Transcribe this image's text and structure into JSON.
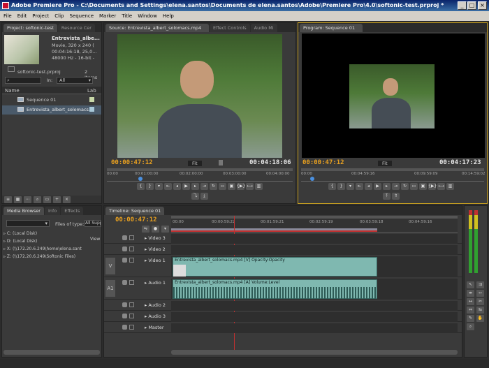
{
  "window": {
    "title": "Adobe Premiere Pro - C:\\Documents and Settings\\elena.santos\\Documents de elena.santos\\Adobe\\Premiere Pro\\4.0\\softonic-test.prproj *"
  },
  "menu": [
    "File",
    "Edit",
    "Project",
    "Clip",
    "Sequence",
    "Marker",
    "Title",
    "Window",
    "Help"
  ],
  "project": {
    "tabs": [
      "Project: softonic-test",
      "Resource Cer"
    ],
    "clip_name": "Entrevista_albe...",
    "clip_info": [
      "Movie, 320 x 240 (",
      "00:04:16:18, 25,0...",
      "48000 Hz - 16-bit -"
    ],
    "file": "softonic-test.prproj",
    "items": "2 Items",
    "in_label": "In:",
    "in_value": "All",
    "col_name": "Name",
    "col_label": "Lab",
    "rows": [
      "Sequence 01",
      "Entrevista_albert_solomacs."
    ]
  },
  "source": {
    "tabs": [
      "Source: Entrevista_albert_solomacs.mp4",
      "Effect Controls",
      "Audio Mi"
    ],
    "tc_current": "00:00:47:12",
    "fit": "Fit",
    "tc_duration": "00:04:18:06",
    "ruler": [
      "00:00",
      "00:01:00:00",
      "00:02:00:00",
      "00:03:00:00",
      "00:04:00:00"
    ],
    "playhead": 0.18
  },
  "program": {
    "tabs": [
      "Program: Sequence 01"
    ],
    "tc_current": "00:00:47:12",
    "fit": "Fit",
    "tc_duration": "00:04:17:23",
    "ruler": [
      "00:00",
      "00:04:59:16",
      "00:09:59:09",
      "00:14:59:02"
    ],
    "playhead": 0.06
  },
  "media_browser": {
    "tabs": [
      "Media Browser",
      "Info",
      "Effects"
    ],
    "files_of_type": "Files of type:",
    "files_value": "All Supp",
    "drives": [
      "C: (Local Disk)",
      "D: (Local Disk)",
      "X: (\\\\172.20.6.249\\home\\elena.sant",
      "Z: (\\\\172.20.6.249\\Softonic Files)"
    ],
    "view_label": "View"
  },
  "timeline": {
    "tab": "Timeline: Sequence 01",
    "tc": "00:00:47:12",
    "ruler": [
      "00:00",
      "00:00:59:22",
      "00:01:59:21",
      "00:02:59:19",
      "00:03:59:18",
      "00:04:59:16"
    ],
    "playhead": 0.22,
    "tracks": [
      {
        "label": "Video 3",
        "kind": "v"
      },
      {
        "label": "Video 2",
        "kind": "v"
      },
      {
        "label": "Video 1",
        "kind": "v",
        "src": "V",
        "clip": "Entrevista_albert_solomacs.mp4 [V]  Opacity:Opacity"
      },
      {
        "label": "Audio 1",
        "kind": "a",
        "src": "A1",
        "clip": "Entrevista_albert_solomacs.mp4 [A]  Volume:Level"
      },
      {
        "label": "Audio 2",
        "kind": "a"
      },
      {
        "label": "Audio 3",
        "kind": "a"
      },
      {
        "label": "Master",
        "kind": "m"
      }
    ],
    "clip_end_fraction": 0.72
  },
  "colors": {
    "accent_timecode": "#e8a020",
    "clip": "#7fb8b0",
    "playhead": "#c03030"
  }
}
